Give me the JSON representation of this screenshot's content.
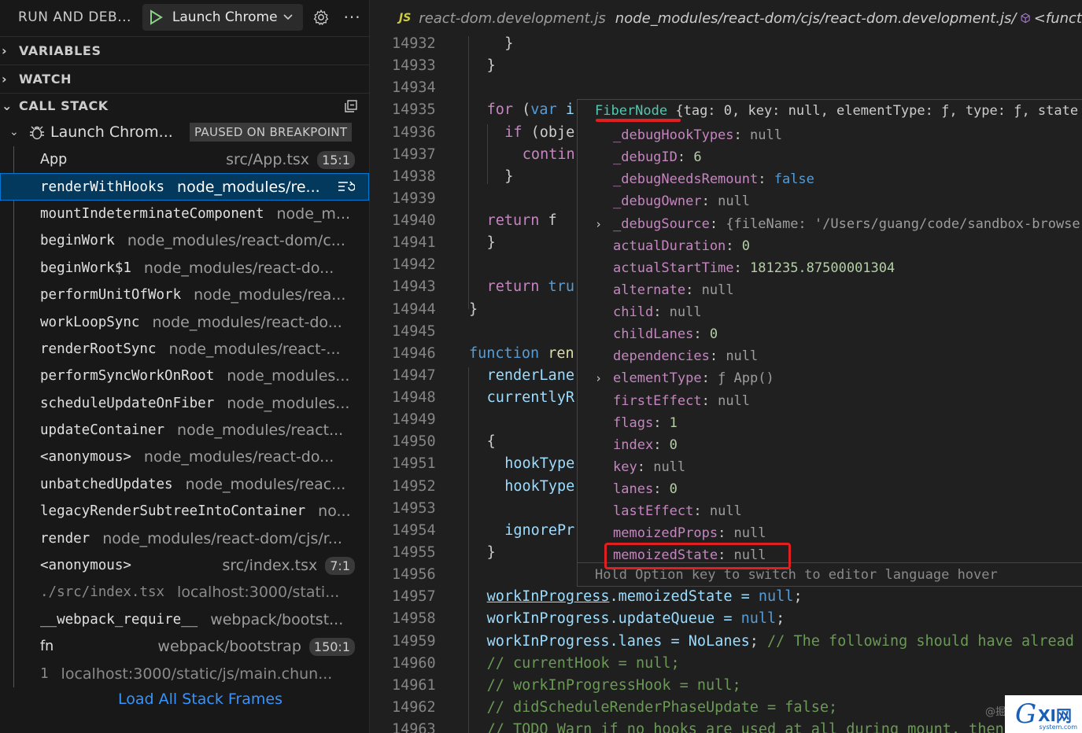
{
  "sidebar": {
    "title": "RUN AND DEB...",
    "launch_label": "Launch Chrome",
    "more_label": "···",
    "sections": {
      "variables": "VARIABLES",
      "watch": "WATCH",
      "call_stack": "CALL STACK"
    },
    "thread": {
      "name": "Launch Chrom...",
      "status": "PAUSED ON BREAKPOINT"
    },
    "frames": [
      {
        "name": "App",
        "source": "src/App.tsx",
        "badge": "15:1"
      },
      {
        "name": "renderWithHooks",
        "source": "node_modules/re...",
        "selected": true
      },
      {
        "name": "mountIndeterminateComponent",
        "source": "node_m..."
      },
      {
        "name": "beginWork",
        "source": "node_modules/react-dom/c..."
      },
      {
        "name": "beginWork$1",
        "source": "node_modules/react-do..."
      },
      {
        "name": "performUnitOfWork",
        "source": "node_modules/rea..."
      },
      {
        "name": "workLoopSync",
        "source": "node_modules/react-do..."
      },
      {
        "name": "renderRootSync",
        "source": "node_modules/react-..."
      },
      {
        "name": "performSyncWorkOnRoot",
        "source": "node_modules..."
      },
      {
        "name": "scheduleUpdateOnFiber",
        "source": "node_modules..."
      },
      {
        "name": "updateContainer",
        "source": "node_modules/react..."
      },
      {
        "name": "<anonymous>",
        "source": "node_modules/react-do..."
      },
      {
        "name": "unbatchedUpdates",
        "source": "node_modules/reac..."
      },
      {
        "name": "legacyRenderSubtreeIntoContainer",
        "source": "no..."
      },
      {
        "name": "render",
        "source": "node_modules/react-dom/cjs/r..."
      },
      {
        "name": "<anonymous>",
        "source": "src/index.tsx",
        "badge": "7:1"
      },
      {
        "name": "./src/index.tsx",
        "source": "localhost:3000/stati...",
        "dim": true
      },
      {
        "name": "__webpack_require__",
        "source": "webpack/bootst..."
      },
      {
        "name": "fn",
        "source": "webpack/bootstrap",
        "badge": "150:1"
      },
      {
        "name": "1",
        "source": "localhost:3000/static/js/main.chun...",
        "dim": true
      }
    ],
    "load_all": "Load All Stack Frames"
  },
  "editor": {
    "tab_badge": "JS",
    "tab_file": "react-dom.development.js",
    "tab_path": "node_modules/react-dom/cjs/react-dom.development.js/",
    "tab_func": "<funct",
    "line_numbers": [
      "14932",
      "14933",
      "14934",
      "14935",
      "14936",
      "14937",
      "14938",
      "14939",
      "14940",
      "14941",
      "14942",
      "14943",
      "14944",
      "14945",
      "14946",
      "14947",
      "14948",
      "14949",
      "14950",
      "14951",
      "14952",
      "14953",
      "14954",
      "14955",
      "14956",
      "14957",
      "14958",
      "14959",
      "14960",
      "14961",
      "14962",
      "14963"
    ],
    "code_fragments": {
      "l14932": "}",
      "l14933": "}",
      "l14935_for": "for",
      "l14935_rest": " (",
      "l14935_var": "var",
      "l14935_i": " i",
      "l14936_if": "if",
      "l14936_rest": " (obje",
      "l14937": "contin",
      "l14938": "}",
      "l14940_ret": "return",
      "l14940_rest": " f",
      "l14941": "}",
      "l14943_ret": "return",
      "l14943_rest": " tru",
      "l14944": "}",
      "l14946_fn": "function",
      "l14946_rest": " ren",
      "l14947": "renderLane",
      "l14948": "currentlyR",
      "l14950": "{",
      "l14951": "hookType",
      "l14952": "hookType",
      "l14954": "ignorePr",
      "l14955": "}",
      "l14957_a": "workInProgress",
      "l14957_b": ".memoizedState = ",
      "l14957_c": "null",
      "l14957_d": ";",
      "l14958_a": "workInProgress.updateQueue = ",
      "l14958_c": "null",
      "l14958_d": ";",
      "l14959_a": "workInProgress.lanes = ",
      "l14959_b": "NoLanes",
      "l14959_c": "; ",
      "l14959_d": "// The following should have alread",
      "l14960": "// currentHook = null;",
      "l14961": "// workInProgressHook = null;",
      "l14962": "// didScheduleRenderPhaseUpdate = false;",
      "l14963": "// TODO Warn if no hooks are used at all during mount, then"
    }
  },
  "hover": {
    "header_type": "FiberNode",
    "header_rest": " {tag: 0, key: null, elementType: ƒ, type: ƒ, state",
    "props": [
      {
        "key": "_debugHookTypes",
        "value": "null",
        "kind": "null"
      },
      {
        "key": "_debugID",
        "value": "6",
        "kind": "num"
      },
      {
        "key": "_debugNeedsRemount",
        "value": "false",
        "kind": "bool"
      },
      {
        "key": "_debugOwner",
        "value": "null",
        "kind": "null"
      },
      {
        "key": "_debugSource",
        "value": "{fileName: '/Users/guang/code/sandbox-browse",
        "kind": "obj",
        "expandable": true
      },
      {
        "key": "actualDuration",
        "value": "0",
        "kind": "num"
      },
      {
        "key": "actualStartTime",
        "value": "181235.87500001304",
        "kind": "num"
      },
      {
        "key": "alternate",
        "value": "null",
        "kind": "null"
      },
      {
        "key": "child",
        "value": "null",
        "kind": "null"
      },
      {
        "key": "childLanes",
        "value": "0",
        "kind": "num"
      },
      {
        "key": "dependencies",
        "value": "null",
        "kind": "null"
      },
      {
        "key": "elementType",
        "value": "ƒ App()",
        "kind": "fn",
        "expandable": true
      },
      {
        "key": "firstEffect",
        "value": "null",
        "kind": "null"
      },
      {
        "key": "flags",
        "value": "1",
        "kind": "num"
      },
      {
        "key": "index",
        "value": "0",
        "kind": "num"
      },
      {
        "key": "key",
        "value": "null",
        "kind": "null"
      },
      {
        "key": "lanes",
        "value": "0",
        "kind": "num"
      },
      {
        "key": "lastEffect",
        "value": "null",
        "kind": "null"
      },
      {
        "key": "memoizedProps",
        "value": "null",
        "kind": "null"
      },
      {
        "key": "memoizedState",
        "value": "null",
        "kind": "null"
      }
    ],
    "footer": "Hold Option key to switch to editor language hover"
  },
  "watermark": {
    "g": "G",
    "text": "XI网",
    "sub": "system.com",
    "at": "@掘"
  },
  "colors": {
    "accent": "#0078d4",
    "selection": "#04395e",
    "highlight_red": "#e02020",
    "play_green": "#89d185"
  }
}
